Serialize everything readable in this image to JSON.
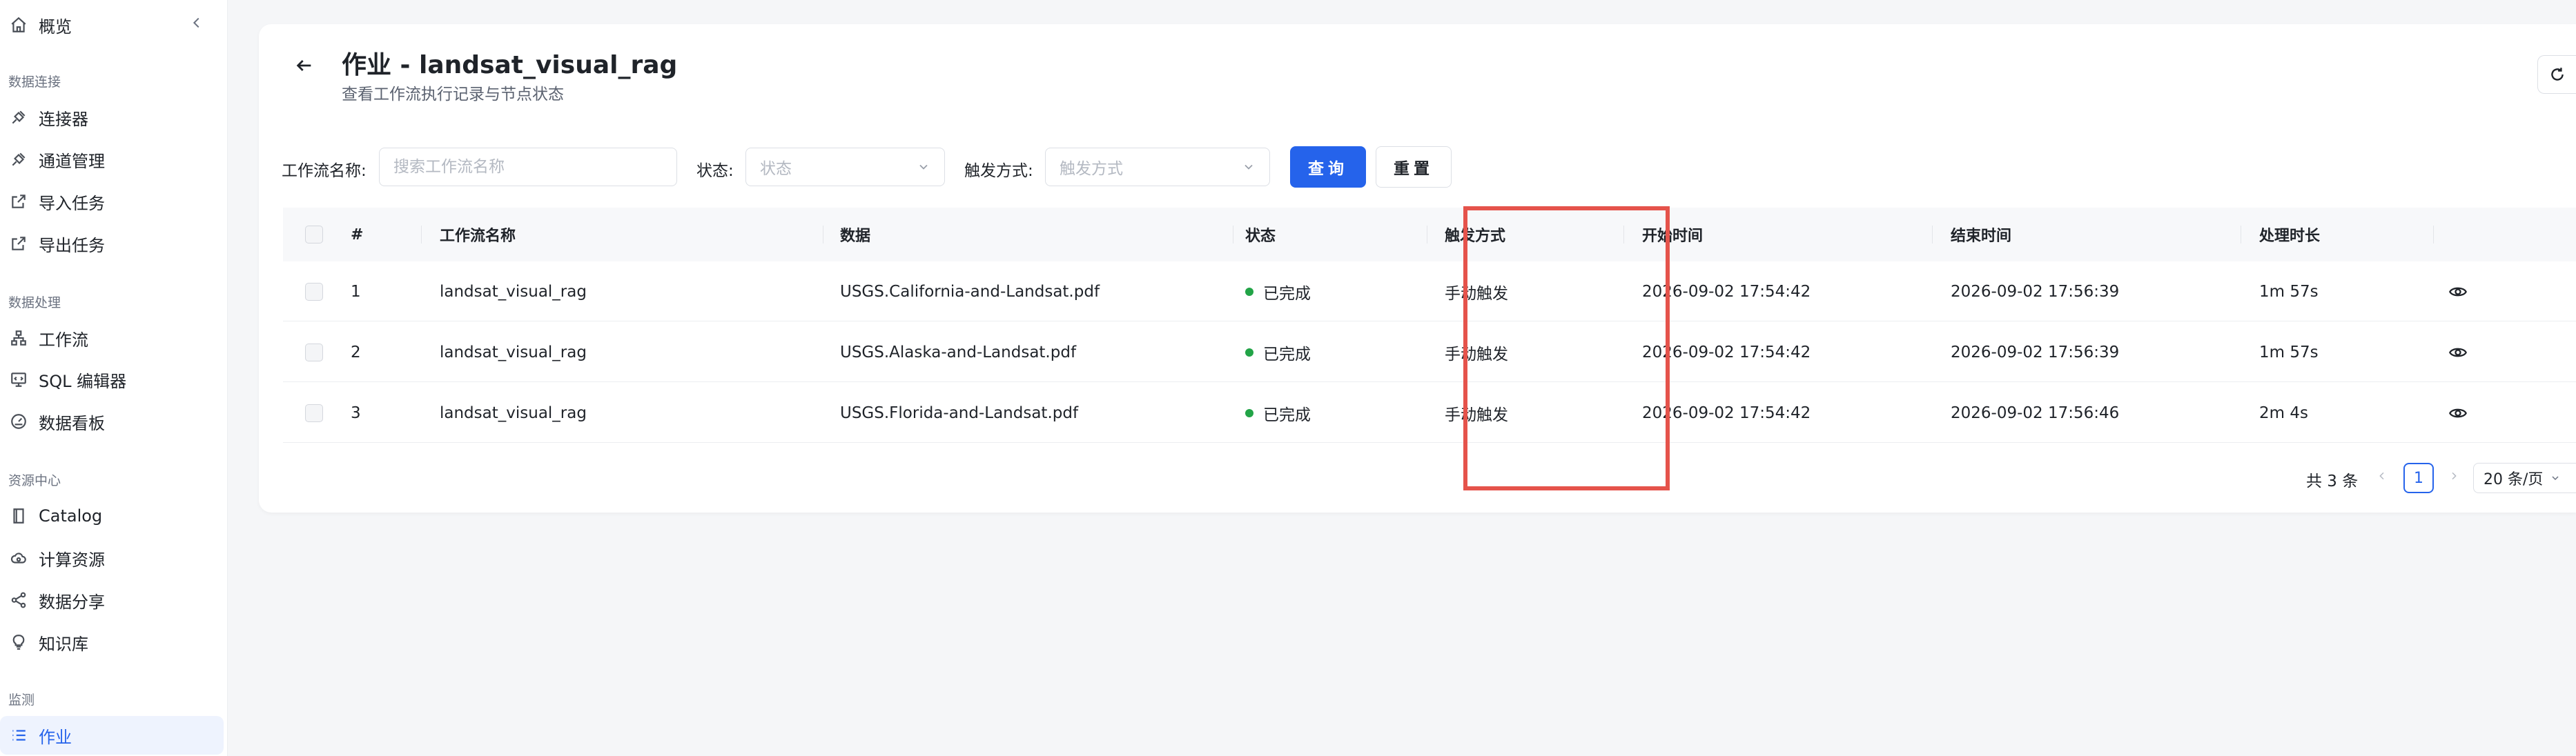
{
  "sidebar": {
    "top_item": "概览",
    "sections": [
      {
        "title": "数据连接",
        "items": [
          "连接器",
          "通道管理",
          "导入任务",
          "导出任务"
        ]
      },
      {
        "title": "数据处理",
        "items": [
          "工作流",
          "SQL 编辑器",
          "数据看板"
        ]
      },
      {
        "title": "资源中心",
        "items": [
          "Catalog",
          "计算资源",
          "数据分享",
          "知识库"
        ]
      },
      {
        "title": "监测",
        "items": [
          "作业"
        ]
      }
    ],
    "active_item": "作业"
  },
  "header": {
    "title": "作业 - landsat_visual_rag",
    "subtitle": "查看工作流执行记录与节点状态"
  },
  "filters": {
    "workflow_label": "工作流名称:",
    "workflow_placeholder": "搜索工作流名称",
    "status_label": "状态:",
    "status_placeholder": "状态",
    "trigger_label": "触发方式:",
    "trigger_placeholder": "触发方式",
    "query_button": "查询",
    "reset_button": "重置"
  },
  "table": {
    "columns": [
      "#",
      "工作流名称",
      "数据",
      "状态",
      "触发方式",
      "开始时间",
      "结束时间",
      "处理时长"
    ],
    "rows": [
      {
        "index": "1",
        "workflow": "landsat_visual_rag",
        "data": "USGS.California-and-Landsat.pdf",
        "status": "已完成",
        "trigger": "手动触发",
        "start": "2026-09-02 17:54:42",
        "end": "2026-09-02 17:56:39",
        "duration": "1m 57s"
      },
      {
        "index": "2",
        "workflow": "landsat_visual_rag",
        "data": "USGS.Alaska-and-Landsat.pdf",
        "status": "已完成",
        "trigger": "手动触发",
        "start": "2026-09-02 17:54:42",
        "end": "2026-09-02 17:56:39",
        "duration": "1m 57s"
      },
      {
        "index": "3",
        "workflow": "landsat_visual_rag",
        "data": "USGS.Florida-and-Landsat.pdf",
        "status": "已完成",
        "trigger": "手动触发",
        "start": "2026-09-02 17:54:42",
        "end": "2026-09-02 17:56:46",
        "duration": "2m 4s"
      }
    ]
  },
  "pagination": {
    "total": "共 3 条",
    "current_page": "1",
    "page_size": "20 条/页"
  },
  "colors": {
    "accent": "#2563eb",
    "status_done": "#22a447",
    "highlight": "#e5534b"
  }
}
